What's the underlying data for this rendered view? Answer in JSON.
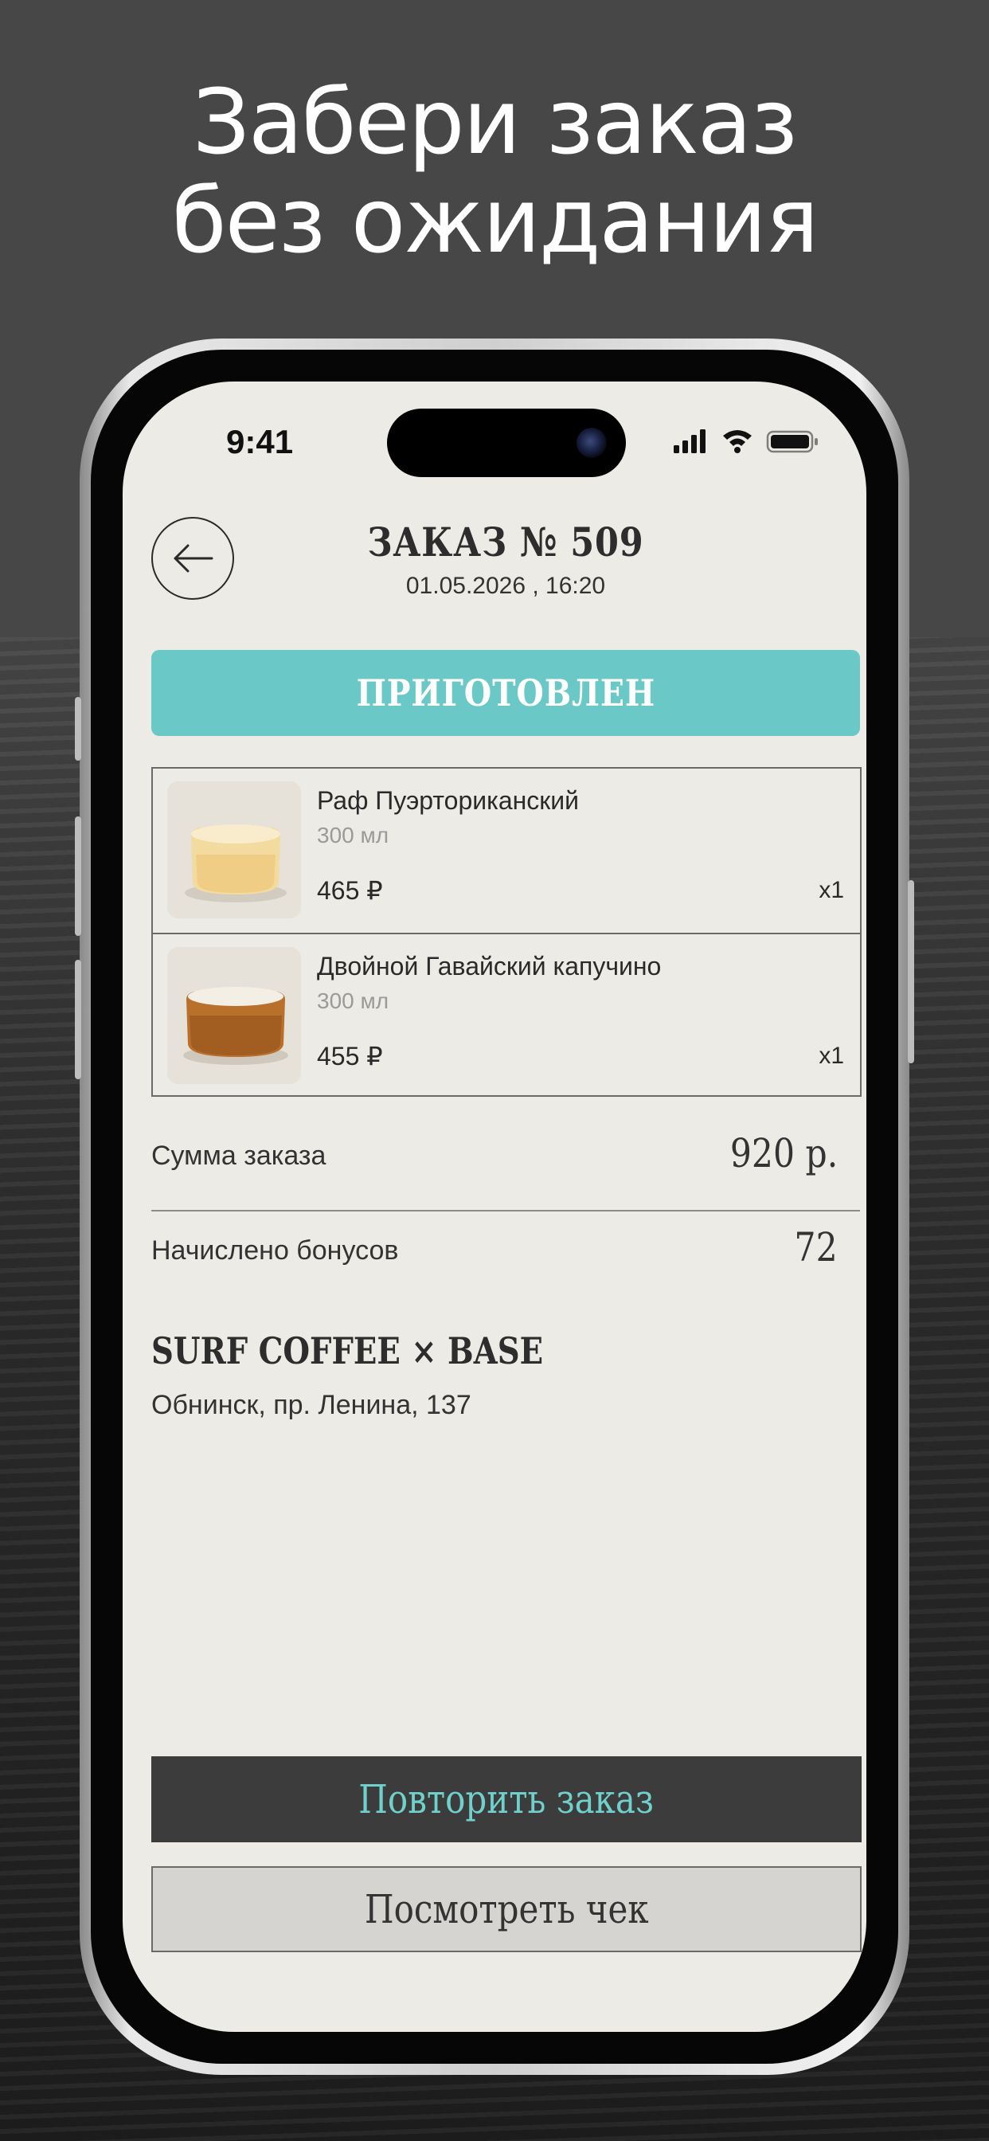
{
  "headline": {
    "line1": "Забери заказ",
    "line2": "без ожидания"
  },
  "status_bar": {
    "time": "9:41"
  },
  "header": {
    "title": "ЗАКАЗ № 509",
    "date": "01.05.2026 , 16:20"
  },
  "order_status": "ПРИГОТОВЛЕН",
  "items": [
    {
      "name": "Раф Пуэрториканский",
      "volume": "300 мл",
      "price": "465 ₽",
      "qty": "x1"
    },
    {
      "name": "Двойной Гавайский капучино",
      "volume": "300 мл",
      "price": "455 ₽",
      "qty": "x1"
    }
  ],
  "summary": {
    "total_label": "Сумма заказа",
    "total_value": "920 р.",
    "bonus_label": "Начислено бонусов",
    "bonus_value": "72"
  },
  "store": {
    "name": "SURF COFFEE × BASE",
    "address": "Обнинск, пр. Ленина, 137"
  },
  "actions": {
    "repeat": "Повторить заказ",
    "receipt": "Посмотреть чек"
  },
  "colors": {
    "accent": "#6ac8c6",
    "screen_bg": "#edebe6",
    "dark_button": "#3c3c3c"
  }
}
